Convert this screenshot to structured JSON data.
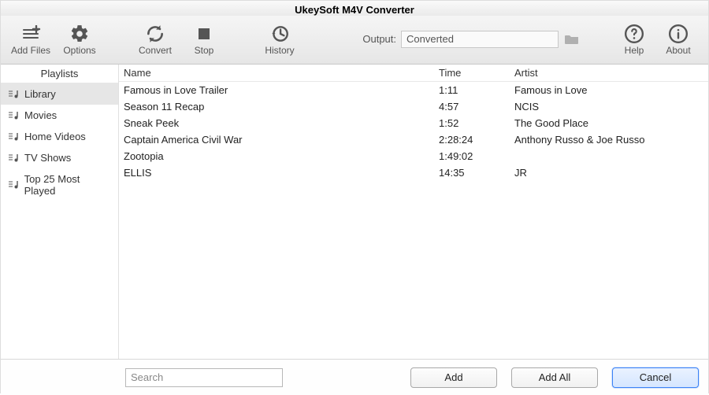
{
  "app": {
    "title": "UkeySoft M4V Converter"
  },
  "toolbar": {
    "add_files": "Add Files",
    "options": "Options",
    "convert": "Convert",
    "stop": "Stop",
    "history": "History",
    "help": "Help",
    "about": "About"
  },
  "output": {
    "label": "Output:",
    "value": "Converted"
  },
  "sidebar": {
    "header": "Playlists",
    "items": [
      {
        "label": "Library",
        "selected": true
      },
      {
        "label": "Movies",
        "selected": false
      },
      {
        "label": "Home Videos",
        "selected": false
      },
      {
        "label": "TV Shows",
        "selected": false
      },
      {
        "label": "Top 25 Most Played",
        "selected": false
      }
    ]
  },
  "table": {
    "columns": {
      "name": "Name",
      "time": "Time",
      "artist": "Artist"
    },
    "rows": [
      {
        "name": "Famous in Love  Trailer",
        "time": "1:11",
        "artist": "Famous in Love"
      },
      {
        "name": "Season 11 Recap",
        "time": "4:57",
        "artist": "NCIS"
      },
      {
        "name": "Sneak Peek",
        "time": "1:52",
        "artist": "The Good Place"
      },
      {
        "name": "Captain America  Civil War",
        "time": "2:28:24",
        "artist": "Anthony Russo & Joe Russo"
      },
      {
        "name": "Zootopia",
        "time": "1:49:02",
        "artist": ""
      },
      {
        "name": "ELLIS",
        "time": "14:35",
        "artist": "JR"
      }
    ]
  },
  "footer": {
    "search_placeholder": "Search",
    "add": "Add",
    "add_all": "Add All",
    "cancel": "Cancel"
  }
}
